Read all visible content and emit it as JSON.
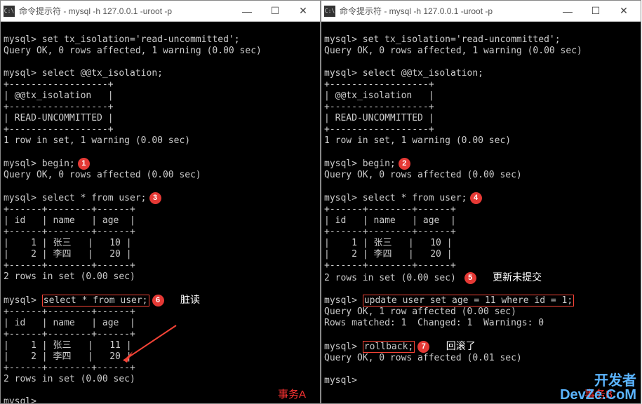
{
  "windowA": {
    "title": "命令提示符 - mysql  -h 127.0.0.1 -uroot -p",
    "controls": {
      "min": "—",
      "max": "☐",
      "close": "✕"
    },
    "icon": "C:\\",
    "bottomLabel": "事务A"
  },
  "windowB": {
    "title": "命令提示符 - mysql  -h 127.0.0.1 -uroot -p",
    "controls": {
      "min": "—",
      "max": "☐",
      "close": "✕"
    },
    "icon": "C:\\",
    "bottomLabel": "事务B"
  },
  "shared": {
    "set_cmd": "mysql> set tx_isolation='read-uncommitted';",
    "set_result": "Query OK, 0 rows affected, 1 warning (0.00 sec)",
    "blank": "",
    "sel_iso_cmd": "mysql> select @@tx_isolation;",
    "tbl_border": "+------------------+",
    "tbl_header": "| @@tx_isolation   |",
    "tbl_value": "| READ-UNCOMMITTED |",
    "one_row": "1 row in set, 1 warning (0.00 sec)",
    "begin_cmd": "mysql> begin;",
    "begin_ok": "Query OK, 0 rows affected (0.00 sec)",
    "sel_user_cmd": "mysql> select * from user;",
    "u_border": "+------+--------+------+",
    "u_header": "| id   | name   | age  |",
    "u_row1": "|    1 | 张三   |   10 |",
    "u_row2": "|    2 | 李四   |   20 |",
    "two_rows": "2 rows in set (0.00 sec)",
    "prompt": "mysql> "
  },
  "leftOnly": {
    "u_row1_dirty": "|    1 | 张三   |   11 |",
    "dirty_label": "脏读"
  },
  "rightOnly": {
    "update_prefix": "mysql> ",
    "update_cmd": "update user set age = 11 where id = 1;",
    "update_ok": "Query OK, 1 row affected (0.00 sec)",
    "update_match": "Rows matched: 1  Changed: 1  Warnings: 0",
    "rollback_prefix": "mysql> ",
    "rollback_cmd": "rollback;",
    "rollback_ok": "Query OK, 0 rows affected (0.01 sec)",
    "update_label": "更新未提交",
    "rollback_label": "回滚了"
  },
  "badges": {
    "b1": "1",
    "b2": "2",
    "b3": "3",
    "b4": "4",
    "b5": "5",
    "b6": "6",
    "b7": "7"
  },
  "watermark": {
    "line1": "开发者",
    "line2": "DevZe.CoM"
  }
}
